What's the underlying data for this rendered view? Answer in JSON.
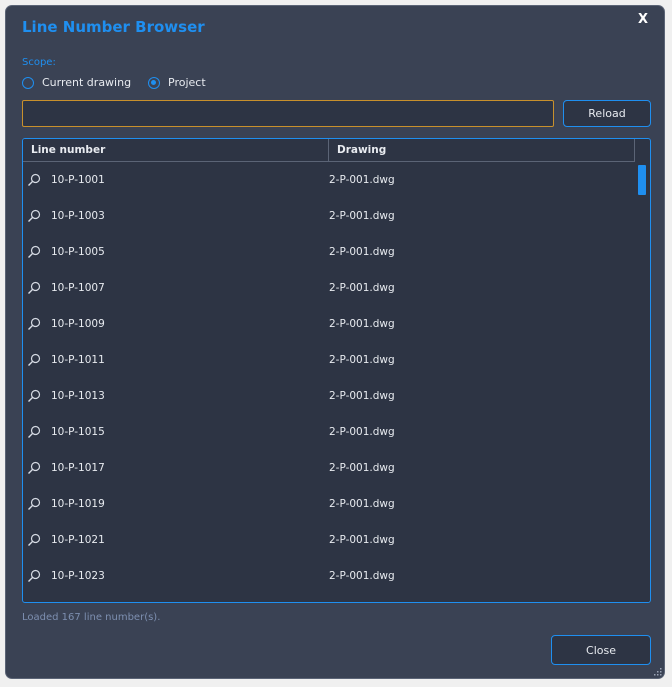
{
  "window": {
    "title": "Line Number Browser",
    "close_glyph": "X"
  },
  "scope": {
    "label": "Scope:",
    "options": [
      {
        "label": "Current drawing",
        "checked": false
      },
      {
        "label": "Project",
        "checked": true
      }
    ]
  },
  "search": {
    "value": "",
    "placeholder": ""
  },
  "toolbar": {
    "reload_label": "Reload"
  },
  "table": {
    "columns": [
      "Line number",
      "Drawing"
    ],
    "rows": [
      {
        "line": "10-P-1001",
        "drawing": "2-P-001.dwg"
      },
      {
        "line": "10-P-1003",
        "drawing": "2-P-001.dwg"
      },
      {
        "line": "10-P-1005",
        "drawing": "2-P-001.dwg"
      },
      {
        "line": "10-P-1007",
        "drawing": "2-P-001.dwg"
      },
      {
        "line": "10-P-1009",
        "drawing": "2-P-001.dwg"
      },
      {
        "line": "10-P-1011",
        "drawing": "2-P-001.dwg"
      },
      {
        "line": "10-P-1013",
        "drawing": "2-P-001.dwg"
      },
      {
        "line": "10-P-1015",
        "drawing": "2-P-001.dwg"
      },
      {
        "line": "10-P-1017",
        "drawing": "2-P-001.dwg"
      },
      {
        "line": "10-P-1019",
        "drawing": "2-P-001.dwg"
      },
      {
        "line": "10-P-1021",
        "drawing": "2-P-001.dwg"
      },
      {
        "line": "10-P-1023",
        "drawing": "2-P-001.dwg"
      }
    ],
    "row_icon": "zoom-icon"
  },
  "status": {
    "text": "Loaded 167 line number(s)."
  },
  "footer": {
    "close_label": "Close"
  },
  "colors": {
    "accent": "#1f8ff0",
    "background": "#3a4254",
    "panel": "#2d3444",
    "input_focus_border": "#c8902c",
    "status_text": "#7d8fb0"
  }
}
